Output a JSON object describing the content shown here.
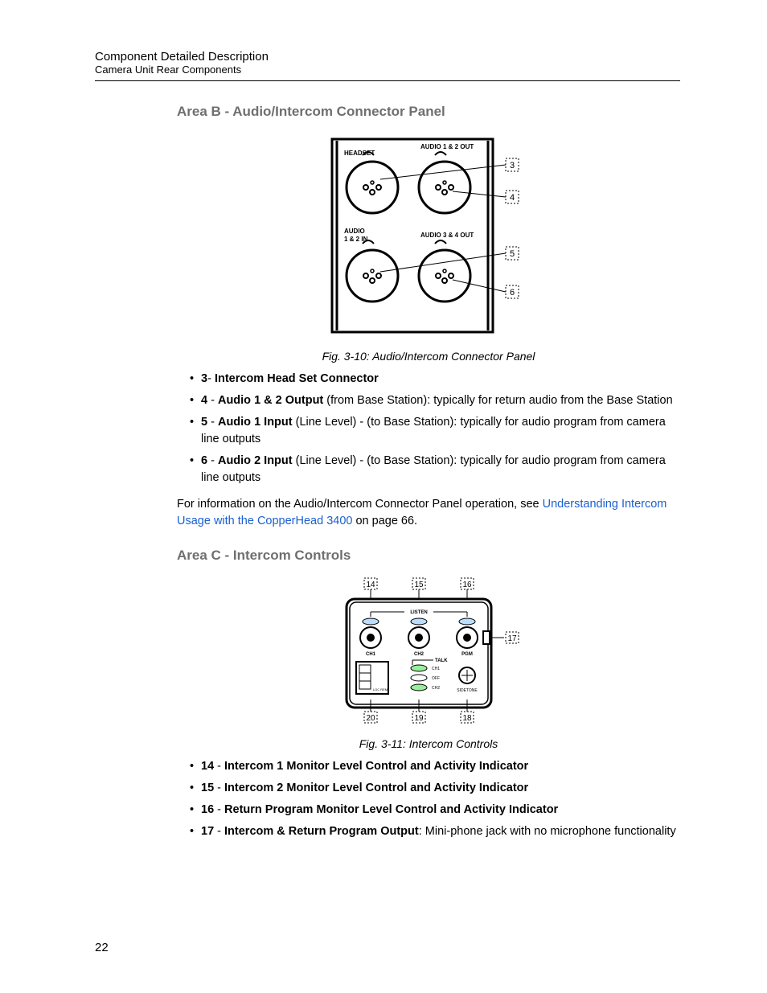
{
  "header": {
    "line1": "Component Detailed Description",
    "line2": "Camera Unit Rear Components"
  },
  "sections": {
    "areaB": {
      "heading": "Area B - Audio/Intercom Connector Panel",
      "figure": {
        "caption": "Fig. 3-10: Audio/Intercom Connector Panel",
        "labels": {
          "headset": "HEADSET",
          "audio12out": "AUDIO 1 & 2 OUT",
          "audio12in_line1": "AUDIO",
          "audio12in_line2": "1 & 2 IN",
          "audio34out": "AUDIO 3 & 4 OUT",
          "callout3": "3",
          "callout4": "4",
          "callout5": "5",
          "callout6": "6"
        }
      },
      "bullets": [
        {
          "num": "3",
          "sep": "- ",
          "title": "Intercom Head Set Connector",
          "desc": ""
        },
        {
          "num": "4",
          "sep": " - ",
          "title": "Audio 1 & 2 Output",
          "desc": " (from Base Station): typically for return audio from the Base Station"
        },
        {
          "num": "5",
          "sep": " - ",
          "title": "Audio 1 Input",
          "desc": " (Line Level) - (to Base Station): typically for audio program from camera line outputs"
        },
        {
          "num": "6",
          "sep": " - ",
          "title": "Audio 2 Input",
          "desc": " (Line Level) - (to Base Station): typically for audio program from camera line outputs"
        }
      ],
      "para_pre": "For information on the Audio/Intercom Connector Panel operation, see ",
      "link": "Understanding Intercom Usage with the CopperHead 3400",
      "para_post": " on page 66."
    },
    "areaC": {
      "heading": "Area C - Intercom Controls",
      "figure": {
        "caption": "Fig. 3-11: Intercom Controls",
        "labels": {
          "c14": "14",
          "c15": "15",
          "c16": "16",
          "c17": "17",
          "c18": "18",
          "c19": "19",
          "c20": "20",
          "listen": "LISTEN",
          "talk": "TALK",
          "ch1": "CH1",
          "ch2": "CH2",
          "pgm": "PGM",
          "ch1s": "CH1",
          "off": "OFF",
          "ch2s": "CH2",
          "sidetone": "SIDETONE",
          "locrem": "LOC REM"
        }
      },
      "bullets": [
        {
          "num": "14",
          "sep": " - ",
          "title": "Intercom 1 Monitor Level Control and Activity Indicator",
          "desc": ""
        },
        {
          "num": "15",
          "sep": " - ",
          "title": "Intercom 2 Monitor Level Control and Activity Indicator",
          "desc": ""
        },
        {
          "num": "16",
          "sep": " - ",
          "title": "Return Program Monitor Level Control and Activity Indicator",
          "desc": ""
        },
        {
          "num": "17",
          "sep": " - ",
          "title": "Intercom & Return Program Output",
          "desc": ": Mini-phone jack with no microphone functionality"
        }
      ]
    }
  },
  "page_number": "22"
}
